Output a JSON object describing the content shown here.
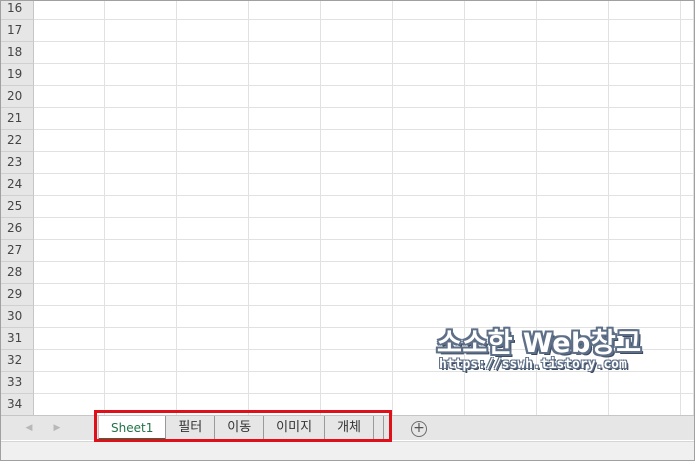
{
  "grid": {
    "rows": [
      "16",
      "17",
      "18",
      "19",
      "20",
      "21",
      "22",
      "23",
      "24",
      "25",
      "26",
      "27",
      "28",
      "29",
      "30",
      "31",
      "32",
      "33",
      "34"
    ]
  },
  "watermark": {
    "title": "소소한 Web창고",
    "url": "https://sswh.tistory.com"
  },
  "sheet_tabs": [
    {
      "label": "Sheet1",
      "active": true
    },
    {
      "label": "필터",
      "active": false
    },
    {
      "label": "이동",
      "active": false
    },
    {
      "label": "이미지",
      "active": false
    },
    {
      "label": "개체",
      "active": false
    }
  ],
  "controls": {
    "add_sheet_symbol": "+",
    "prev_arrow": "◀",
    "next_arrow": "▶"
  },
  "colors": {
    "active_tab": "#217346",
    "highlight_box": "#e0101a",
    "header_bg": "#e6e6e6"
  }
}
